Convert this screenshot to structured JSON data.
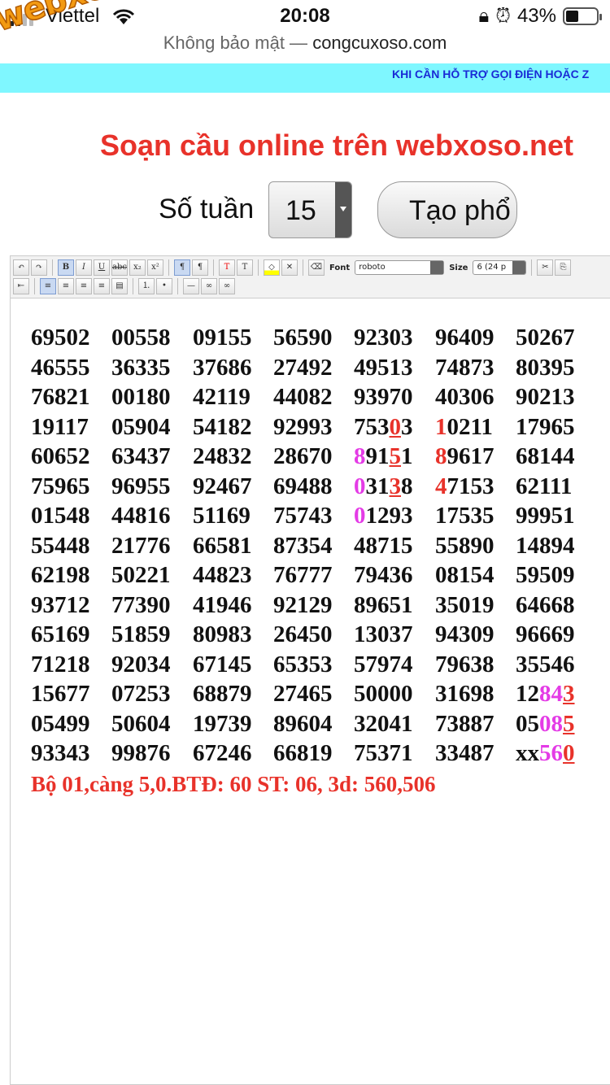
{
  "status_bar": {
    "carrier": "Viettel",
    "time": "20:08",
    "battery": "43%",
    "battery_level": 0.43,
    "page_security": "Không bảo mật —",
    "domain": "congcuxoso.com"
  },
  "logo": "webxoso.net",
  "marquee": "KHI CẦN HỖ TRỢ GỌI ĐIỆN HOẶC Z",
  "title": "Soạn cầu online trên webxoso.net",
  "controls": {
    "weeks_label": "Số tuần",
    "weeks_value": "15",
    "create_label": "Tạo phổ"
  },
  "toolbar": {
    "font_label": "Font",
    "font_value": "roboto",
    "size_label": "Size",
    "size_value": "6 (24 p"
  },
  "rows": [
    [
      "69502",
      "00558",
      "09155",
      "56590",
      "92303",
      "96409",
      "50267"
    ],
    [
      "46555",
      "36335",
      "37686",
      "27492",
      "49513",
      "74873",
      "80395"
    ],
    [
      "76821",
      "00180",
      "42119",
      "44082",
      "93970",
      "40306",
      "90213"
    ],
    [
      "19117",
      "05904",
      "54182",
      "92993",
      "75303",
      "10211",
      "17965"
    ],
    [
      "60652",
      "63437",
      "24832",
      "28670",
      "89151",
      "89617",
      "68144"
    ],
    [
      "75965",
      "96955",
      "92467",
      "69488",
      "03138",
      "47153",
      "62111"
    ],
    [
      "01548",
      "44816",
      "51169",
      "75743",
      "01293",
      "17535",
      "99951"
    ],
    [
      "55448",
      "21776",
      "66581",
      "87354",
      "48715",
      "55890",
      "14894"
    ],
    [
      "62198",
      "50221",
      "44823",
      "76777",
      "79436",
      "08154",
      "59509"
    ],
    [
      "93712",
      "77390",
      "41946",
      "92129",
      "89651",
      "35019",
      "64668"
    ],
    [
      "65169",
      "51859",
      "80983",
      "26450",
      "13037",
      "94309",
      "96669"
    ],
    [
      "71218",
      "92034",
      "67145",
      "65353",
      "57974",
      "79638",
      "35546"
    ],
    [
      "15677",
      "07253",
      "68879",
      "27465",
      "50000",
      "31698",
      "12843"
    ],
    [
      "05499",
      "50604",
      "19739",
      "89604",
      "32041",
      "73887",
      "05085"
    ],
    [
      "93343",
      "99876",
      "67246",
      "66819",
      "75371",
      "33487",
      "xx560"
    ]
  ],
  "highlights": [
    {
      "row": 3,
      "col": 4,
      "chars": [
        {
          "i": 3,
          "style": "red-u"
        }
      ]
    },
    {
      "row": 3,
      "col": 5,
      "chars": [
        {
          "i": 0,
          "style": "red"
        }
      ]
    },
    {
      "row": 4,
      "col": 4,
      "chars": [
        {
          "i": 0,
          "style": "mag"
        },
        {
          "i": 3,
          "style": "red-u"
        }
      ]
    },
    {
      "row": 4,
      "col": 5,
      "chars": [
        {
          "i": 0,
          "style": "red"
        }
      ]
    },
    {
      "row": 5,
      "col": 4,
      "chars": [
        {
          "i": 0,
          "style": "mag"
        },
        {
          "i": 3,
          "style": "red-u"
        }
      ]
    },
    {
      "row": 5,
      "col": 5,
      "chars": [
        {
          "i": 0,
          "style": "red"
        }
      ]
    },
    {
      "row": 6,
      "col": 4,
      "chars": [
        {
          "i": 0,
          "style": "mag"
        }
      ]
    },
    {
      "row": 12,
      "col": 6,
      "chars": [
        {
          "i": 2,
          "style": "mag"
        },
        {
          "i": 3,
          "style": "mag"
        },
        {
          "i": 4,
          "style": "red-u"
        }
      ]
    },
    {
      "row": 13,
      "col": 6,
      "chars": [
        {
          "i": 2,
          "style": "mag"
        },
        {
          "i": 3,
          "style": "mag"
        },
        {
          "i": 4,
          "style": "red-u"
        }
      ]
    },
    {
      "row": 14,
      "col": 6,
      "chars": [
        {
          "i": 2,
          "style": "mag"
        },
        {
          "i": 3,
          "style": "mag"
        },
        {
          "i": 4,
          "style": "red-u"
        }
      ]
    }
  ],
  "summary": "Bộ 01,càng 5,0.BTĐ: 60 ST: 06, 3d: 560,506",
  "colors": {
    "accent_red": "#e8322a",
    "magenta": "#e43be6",
    "marquee_bg": "#7ff7ff",
    "marquee_text": "#1a2bd6"
  }
}
